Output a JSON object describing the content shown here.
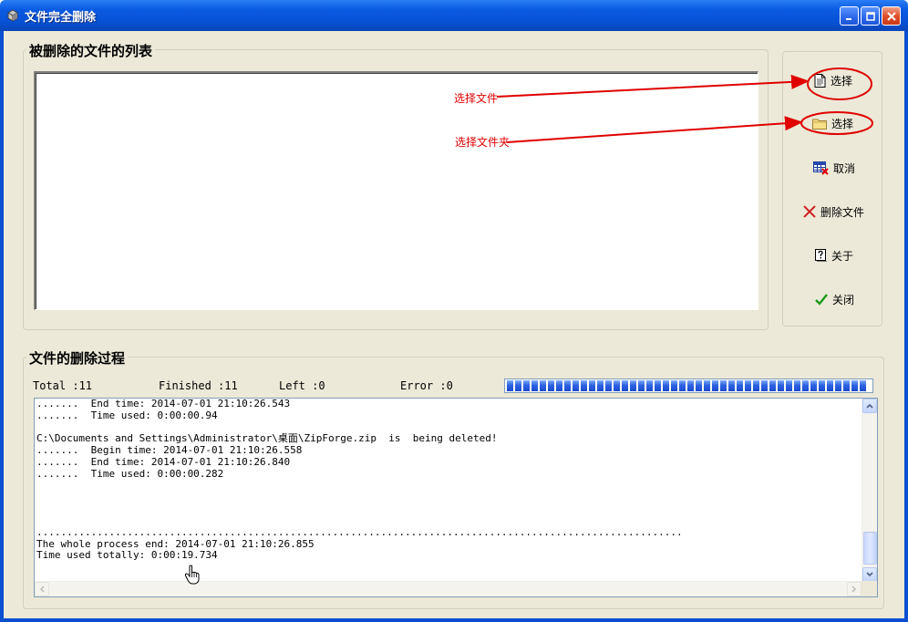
{
  "window": {
    "title": "文件完全删除"
  },
  "file_list_group": {
    "label": "被删除的文件的列表"
  },
  "side_buttons": {
    "select_file_label": "选择",
    "select_folder_label": "选择",
    "cancel_label": "取消",
    "delete_label": "删除文件",
    "about_label": "关于",
    "close_label": "关闭"
  },
  "annotations": {
    "select_file": "选择文件",
    "select_folder": "选择文件夹"
  },
  "process_group": {
    "label": "文件的删除过程"
  },
  "stats": {
    "total": "Total :11",
    "finished": "Finished :11",
    "left": "Left :0",
    "error": "Error :0"
  },
  "progress": {
    "fraction": 1.0
  },
  "log": {
    "lines": [
      ".......  End time: 2014-07-01 21:10:26.543",
      ".......  Time used: 0:00:00.94",
      "",
      "C:\\Documents and Settings\\Administrator\\桌面\\ZipForge.zip  is  being deleted!",
      ".......  Begin time: 2014-07-01 21:10:26.558",
      ".......  End time: 2014-07-01 21:10:26.840",
      ".......  Time used: 0:00:00.282",
      "",
      "",
      "",
      "",
      "...........................................................................................................",
      "The whole process end: 2014-07-01 21:10:26.855",
      "Time used totally: 0:00:19.734"
    ]
  },
  "colors": {
    "accent": "#0a5be2",
    "annotation": "#e00000",
    "face": "#ece9d8"
  }
}
